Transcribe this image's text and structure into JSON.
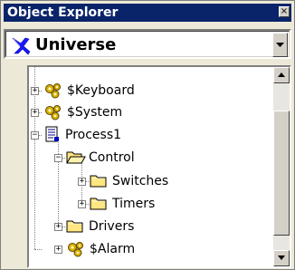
{
  "window": {
    "title": "Object Explorer",
    "close_glyph": "×"
  },
  "combo": {
    "selected": "Universe",
    "icon": "universe-icon"
  },
  "tree": {
    "items": [
      {
        "label": "$Keyboard",
        "icon": "gear-cluster-icon",
        "expander": "+"
      },
      {
        "label": "$System",
        "icon": "gear-cluster-icon",
        "expander": "+"
      },
      {
        "label": "Process1",
        "icon": "document-icon",
        "expander": "−"
      },
      {
        "label": "Control",
        "icon": "open-folder-icon",
        "expander": "−"
      },
      {
        "label": "Switches",
        "icon": "folder-icon",
        "expander": "+"
      },
      {
        "label": "Timers",
        "icon": "folder-icon",
        "expander": "+"
      },
      {
        "label": "Drivers",
        "icon": "folder-icon",
        "expander": "+"
      },
      {
        "label": "$Alarm",
        "icon": "gear-cluster-icon",
        "expander": "+"
      }
    ]
  },
  "colors": {
    "titlebar": "#0a246a",
    "folder": "#ffe680",
    "gear": "#d8b000"
  }
}
